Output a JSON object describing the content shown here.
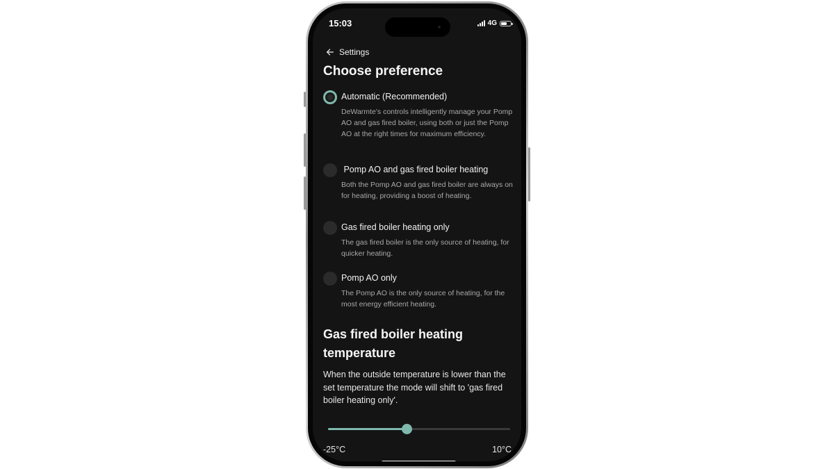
{
  "status_bar": {
    "time": "15:03",
    "network": "4G",
    "battery_level": 0.6
  },
  "nav": {
    "back_label": "Settings"
  },
  "page": {
    "title": "Choose preference"
  },
  "options": [
    {
      "label": "Automatic (Recommended)",
      "description": "DeWarmte’s controls intelligently manage your Pomp AO and gas fired boiler, using both or just the Pomp AO at the right times for maximum efficiency.",
      "selected": true
    },
    {
      "label": " Pomp AO and gas fired boiler heating",
      "description": "Both the Pomp AO and gas fired boiler are always on for heating, providing a boost of heating.",
      "selected": false
    },
    {
      "label": "Gas fired boiler heating only",
      "description": "The gas fired boiler is the only source of heating, for quicker heating.",
      "selected": false
    },
    {
      "label": "Pomp AO only",
      "description": "The Pomp AO is the only source of heating, for the most energy efficient heating.",
      "selected": false
    }
  ],
  "temperature_section": {
    "title": "Gas fired boiler heating temperature",
    "description": "When the outside temperature is lower than the set temperature the mode will shift to 'gas fired boiler heating only'.",
    "slider": {
      "min_label": "-25°C",
      "max_label": "10°C",
      "fraction": 0.43
    }
  },
  "colors": {
    "accent": "#7fb9ad",
    "background": "#141414"
  }
}
